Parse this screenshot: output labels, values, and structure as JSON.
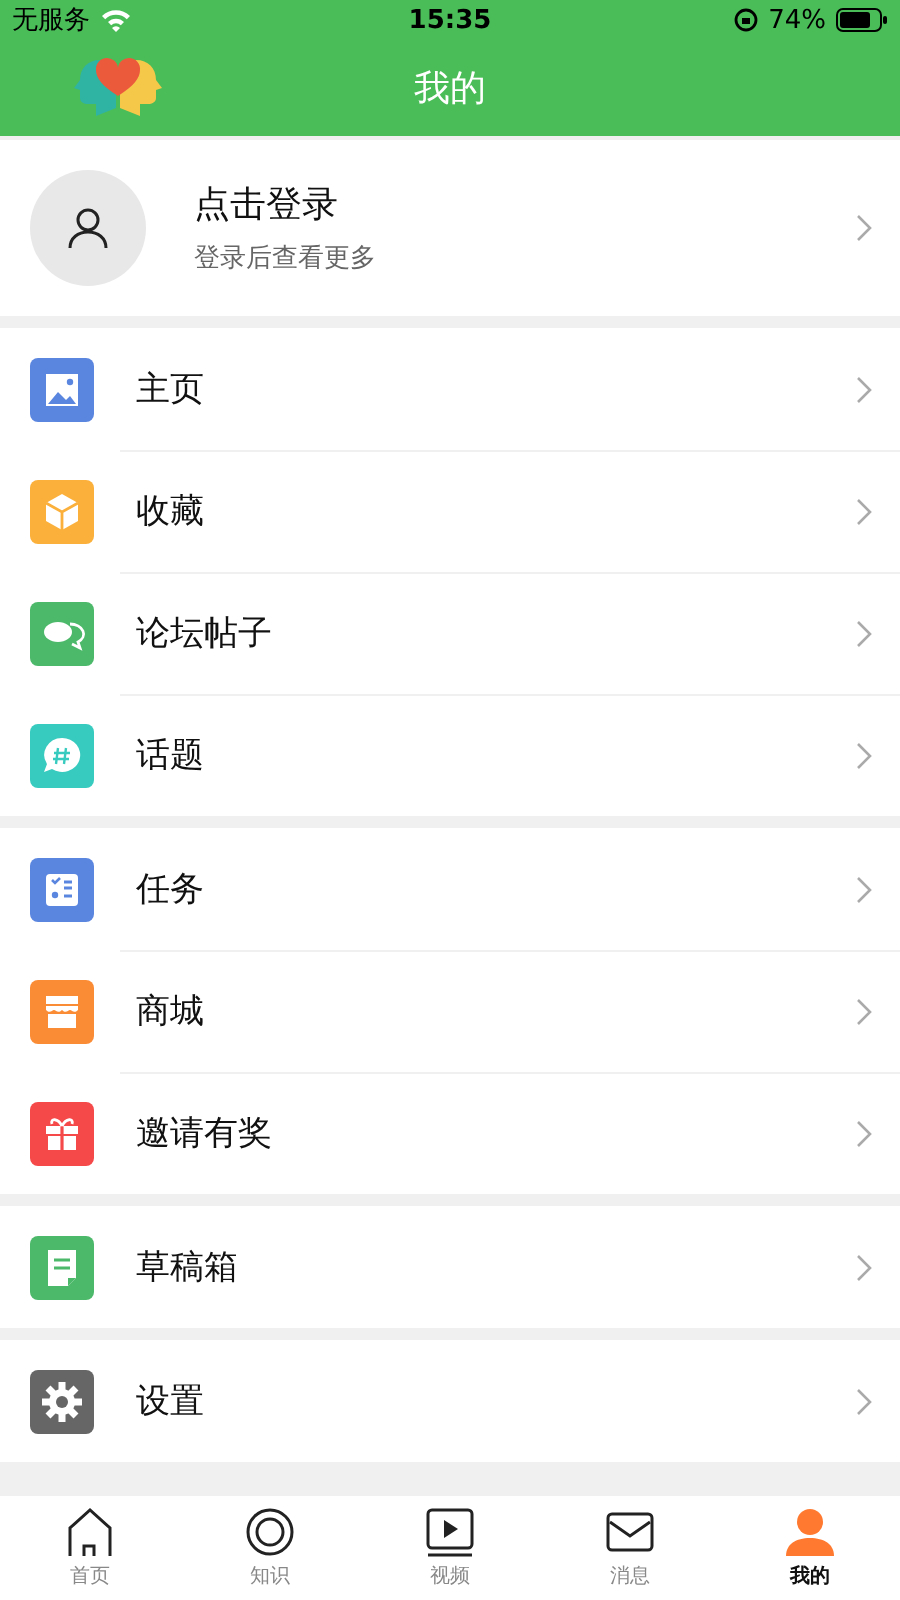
{
  "status_bar": {
    "carrier": "无服务",
    "time": "15:35",
    "battery": "74%"
  },
  "header": {
    "title": "我的"
  },
  "profile": {
    "name": "点击登录",
    "hint": "登录后查看更多"
  },
  "groups": [
    {
      "items": [
        {
          "label": "主页",
          "kind": "image",
          "color": "#5b86e0"
        },
        {
          "label": "收藏",
          "kind": "box",
          "color": "#fbb03b"
        },
        {
          "label": "论坛帖子",
          "kind": "chat",
          "color": "#4cb86a"
        },
        {
          "label": "话题",
          "kind": "topic",
          "color": "#37cbbf"
        }
      ]
    },
    {
      "items": [
        {
          "label": "任务",
          "kind": "task",
          "color": "#5b86e0"
        },
        {
          "label": "商城",
          "kind": "shop",
          "color": "#fb8c36"
        },
        {
          "label": "邀请有奖",
          "kind": "gift",
          "color": "#f54848"
        }
      ]
    },
    {
      "items": [
        {
          "label": "草稿箱",
          "kind": "draft",
          "color": "#4cb86a"
        }
      ]
    },
    {
      "items": [
        {
          "label": "设置",
          "kind": "gear",
          "color": "#666666"
        }
      ]
    }
  ],
  "tabs": [
    {
      "label": "首页",
      "kind": "home",
      "selected": false
    },
    {
      "label": "知识",
      "kind": "ring",
      "selected": false
    },
    {
      "label": "视频",
      "kind": "video",
      "selected": false
    },
    {
      "label": "消息",
      "kind": "mail",
      "selected": false
    },
    {
      "label": "我的",
      "kind": "person",
      "selected": true
    }
  ]
}
